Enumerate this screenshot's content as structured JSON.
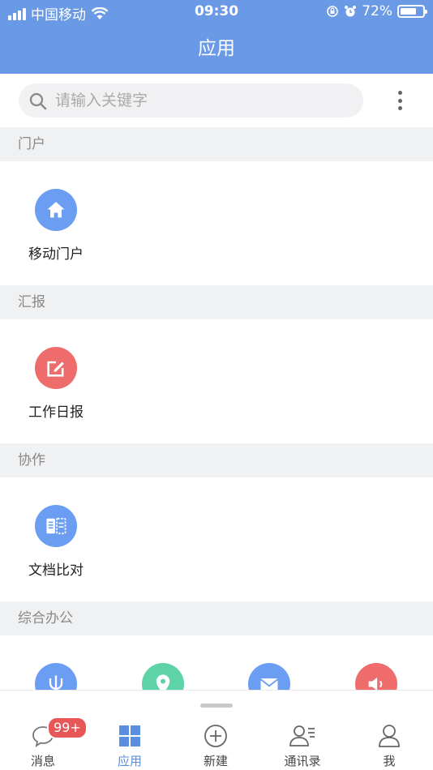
{
  "status_bar": {
    "carrier": "中国移动",
    "time": "09:30",
    "battery": "72%",
    "battery_level": 0.72
  },
  "header": {
    "title": "应用"
  },
  "search": {
    "placeholder": "请输入关键字",
    "value": ""
  },
  "sections": [
    {
      "title": "门户",
      "apps": [
        {
          "label": "移动门户",
          "icon": "home-icon",
          "color": "#6b9df2"
        }
      ]
    },
    {
      "title": "汇报",
      "apps": [
        {
          "label": "工作日报",
          "icon": "edit-icon",
          "color": "#ee6c6c"
        }
      ]
    },
    {
      "title": "协作",
      "apps": [
        {
          "label": "文档比对",
          "icon": "document-compare-icon",
          "color": "#6b9df2"
        }
      ]
    },
    {
      "title": "综合办公",
      "apps": [
        {
          "label": "",
          "icon": "fork-icon",
          "color": "#6b9df2"
        },
        {
          "label": "",
          "icon": "location-pin-icon",
          "color": "#5fd3a8"
        },
        {
          "label": "",
          "icon": "mail-icon",
          "color": "#6b9df2"
        },
        {
          "label": "",
          "icon": "speaker-icon",
          "color": "#ee6c6c"
        }
      ]
    }
  ],
  "tabbar": {
    "tabs": [
      {
        "label": "消息",
        "icon": "chat-bubble-icon",
        "badge": "99+"
      },
      {
        "label": "应用",
        "icon": "grid-icon",
        "active": true
      },
      {
        "label": "新建",
        "icon": "plus-circle-icon"
      },
      {
        "label": "通讯录",
        "icon": "contacts-icon"
      },
      {
        "label": "我",
        "icon": "person-icon"
      }
    ]
  },
  "colors": {
    "primary": "#6a9ae6",
    "badge": "#e85757"
  }
}
